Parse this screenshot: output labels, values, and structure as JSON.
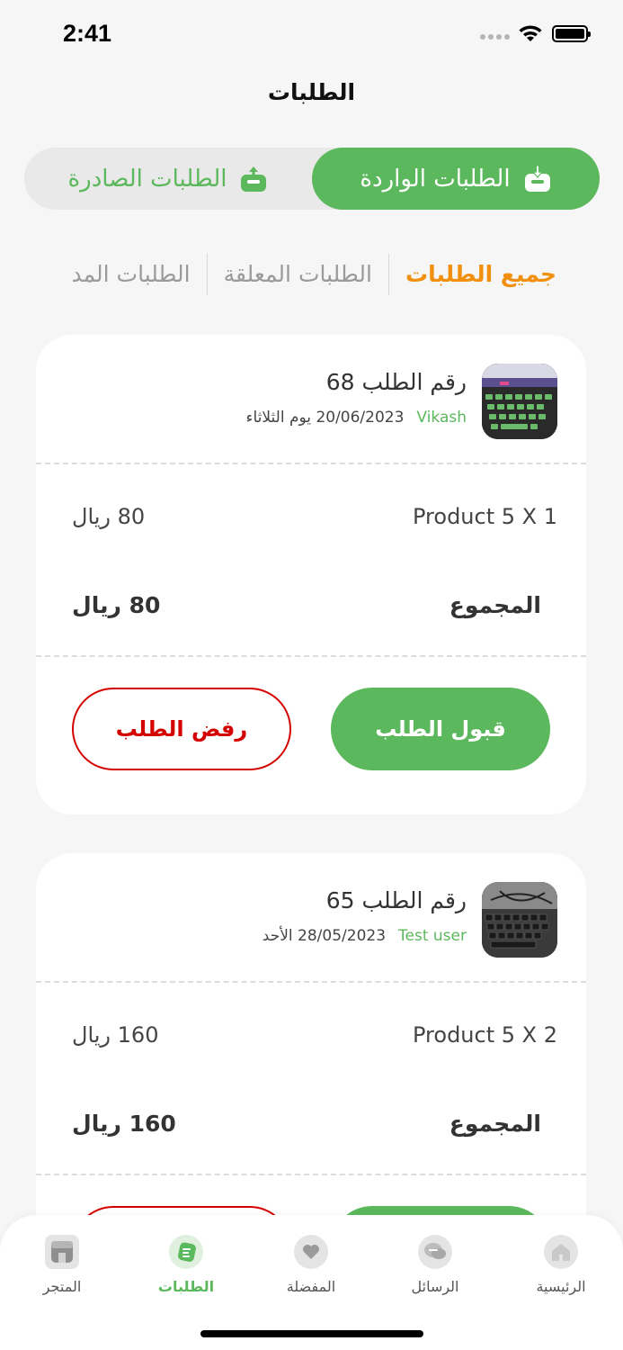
{
  "status": {
    "time": "2:41"
  },
  "header": {
    "title": "الطلبات"
  },
  "segments": {
    "incoming": "الطلبات الواردة",
    "outgoing": "الطلبات الصادرة"
  },
  "filters": [
    "جميع الطلبات",
    "الطلبات المعلقة",
    "الطلبات المد"
  ],
  "orders": [
    {
      "number_label": "رقم الطلب  68",
      "customer": "Vikash",
      "date": "20/06/2023 يوم الثلاثاء",
      "item_name": "Product 5  X 1",
      "item_price": "80  ريال",
      "total_label": "المجموع",
      "total_value": "80  ريال",
      "accept_label": "قبول الطلب",
      "reject_label": "رفض الطلب"
    },
    {
      "number_label": "رقم الطلب  65",
      "customer": "Test user",
      "date": "28/05/2023 الأحد",
      "item_name": "Product 5  X 2",
      "item_price": "160  ريال",
      "total_label": "المجموع",
      "total_value": "160  ريال"
    }
  ],
  "tabbar": {
    "home": "الرئيسية",
    "messages": "الرسائل",
    "favorites": "المفضلة",
    "orders": "الطلبات",
    "store": "المتجر"
  },
  "colors": {
    "accent": "#5cb85c",
    "active_filter": "#f0900e",
    "reject": "#d40000"
  }
}
